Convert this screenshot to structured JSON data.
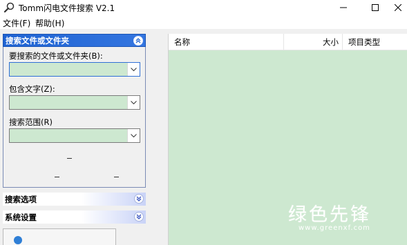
{
  "window": {
    "title": "Tomm闪电文件搜索 V2.1",
    "icon": "search-magnifier-icon",
    "controls": {
      "minimize": "minimize-icon",
      "maximize": "maximize-icon",
      "close": "close-icon"
    }
  },
  "menu": {
    "file": "文件(F)",
    "help": "帮助(H)"
  },
  "sidebar": {
    "search_section": {
      "title": "搜索文件或文件夹",
      "fields": [
        {
          "label": "要搜索的文件或文件夹(B):",
          "value": ""
        },
        {
          "label": "包含文字(Z):",
          "value": ""
        },
        {
          "label": "搜索范围(R)",
          "value": ""
        }
      ]
    },
    "options_section": {
      "title": "搜索选项"
    },
    "settings_section": {
      "title": "系统设置"
    }
  },
  "list": {
    "columns": [
      "名称",
      "大小",
      "项目类型"
    ],
    "rows": []
  },
  "watermark": {
    "logo": "绿色先锋",
    "url": "www.greenxf.com"
  },
  "colors": {
    "list_background": "#cde8d0",
    "section_header_active": "#1f63d2",
    "section_header_inactive": "#c9d3f7"
  }
}
